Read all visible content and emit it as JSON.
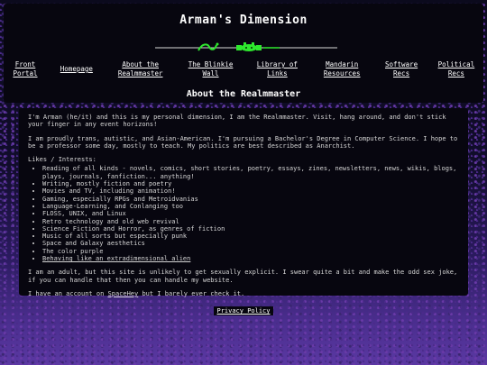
{
  "site": {
    "title": "Arman's Dimension",
    "section_title": "About the Realmmaster"
  },
  "nav": [
    {
      "label": "Front Portal"
    },
    {
      "label": "Homepage"
    },
    {
      "label": "About the Realmmaster"
    },
    {
      "label": "The Blinkie Wall"
    },
    {
      "label": "Library of Links"
    },
    {
      "label": "Mandarin Resources"
    },
    {
      "label": "Software Recs"
    },
    {
      "label": "Political Recs"
    }
  ],
  "content": {
    "intro": "I'm Arman (he/it) and this is my personal dimension, I am the Realmmaster. Visit, hang around, and don't stick your finger in any event horizons!",
    "bio": "I am proudly trans, autistic, and Asian-American. I'm pursuing a Bachelor's Degree in Computer Science. I hope to be a professor some day, mostly to teach. My politics are best described as Anarchist.",
    "likes_heading": "Likes / Interests:",
    "likes": [
      "Reading of all kinds - novels, comics, short stories, poetry, essays, zines, newsletters, news, wikis, blogs, plays, journals, fanfiction... anything!",
      "Writing, mostly fiction and poetry",
      "Movies and TV, including animation!",
      "Gaming, especially RPGs and Metroidvanias",
      "Language-Learning, and Conlanging too",
      "FLOSS, UNIX, and Linux",
      "Retro technology and old web revival",
      "Science Fiction and Horror, as genres of fiction",
      "Music of all sorts but especially punk",
      "Space and Galaxy aesthetics",
      "The color purple",
      "Behaving like an extradimensional alien"
    ],
    "adult_note": "I am an adult, but this site is unlikely to get sexually explicit. I swear quite a bit and make the odd sex joke, if you can handle that then you can handle my website.",
    "spacehey_prefix": "I have an account on ",
    "spacehey_link": "SpaceHey",
    "spacehey_suffix": " but I barely ever check it."
  },
  "footer": {
    "privacy_label": "Privacy Policy"
  },
  "colors": {
    "panel": "#07060f",
    "background_top": "#0b0a1d",
    "background_bottom": "#5a38a2",
    "ornament": "#2ee82e"
  },
  "icons": {
    "ornament": "green-dragon-divider"
  }
}
